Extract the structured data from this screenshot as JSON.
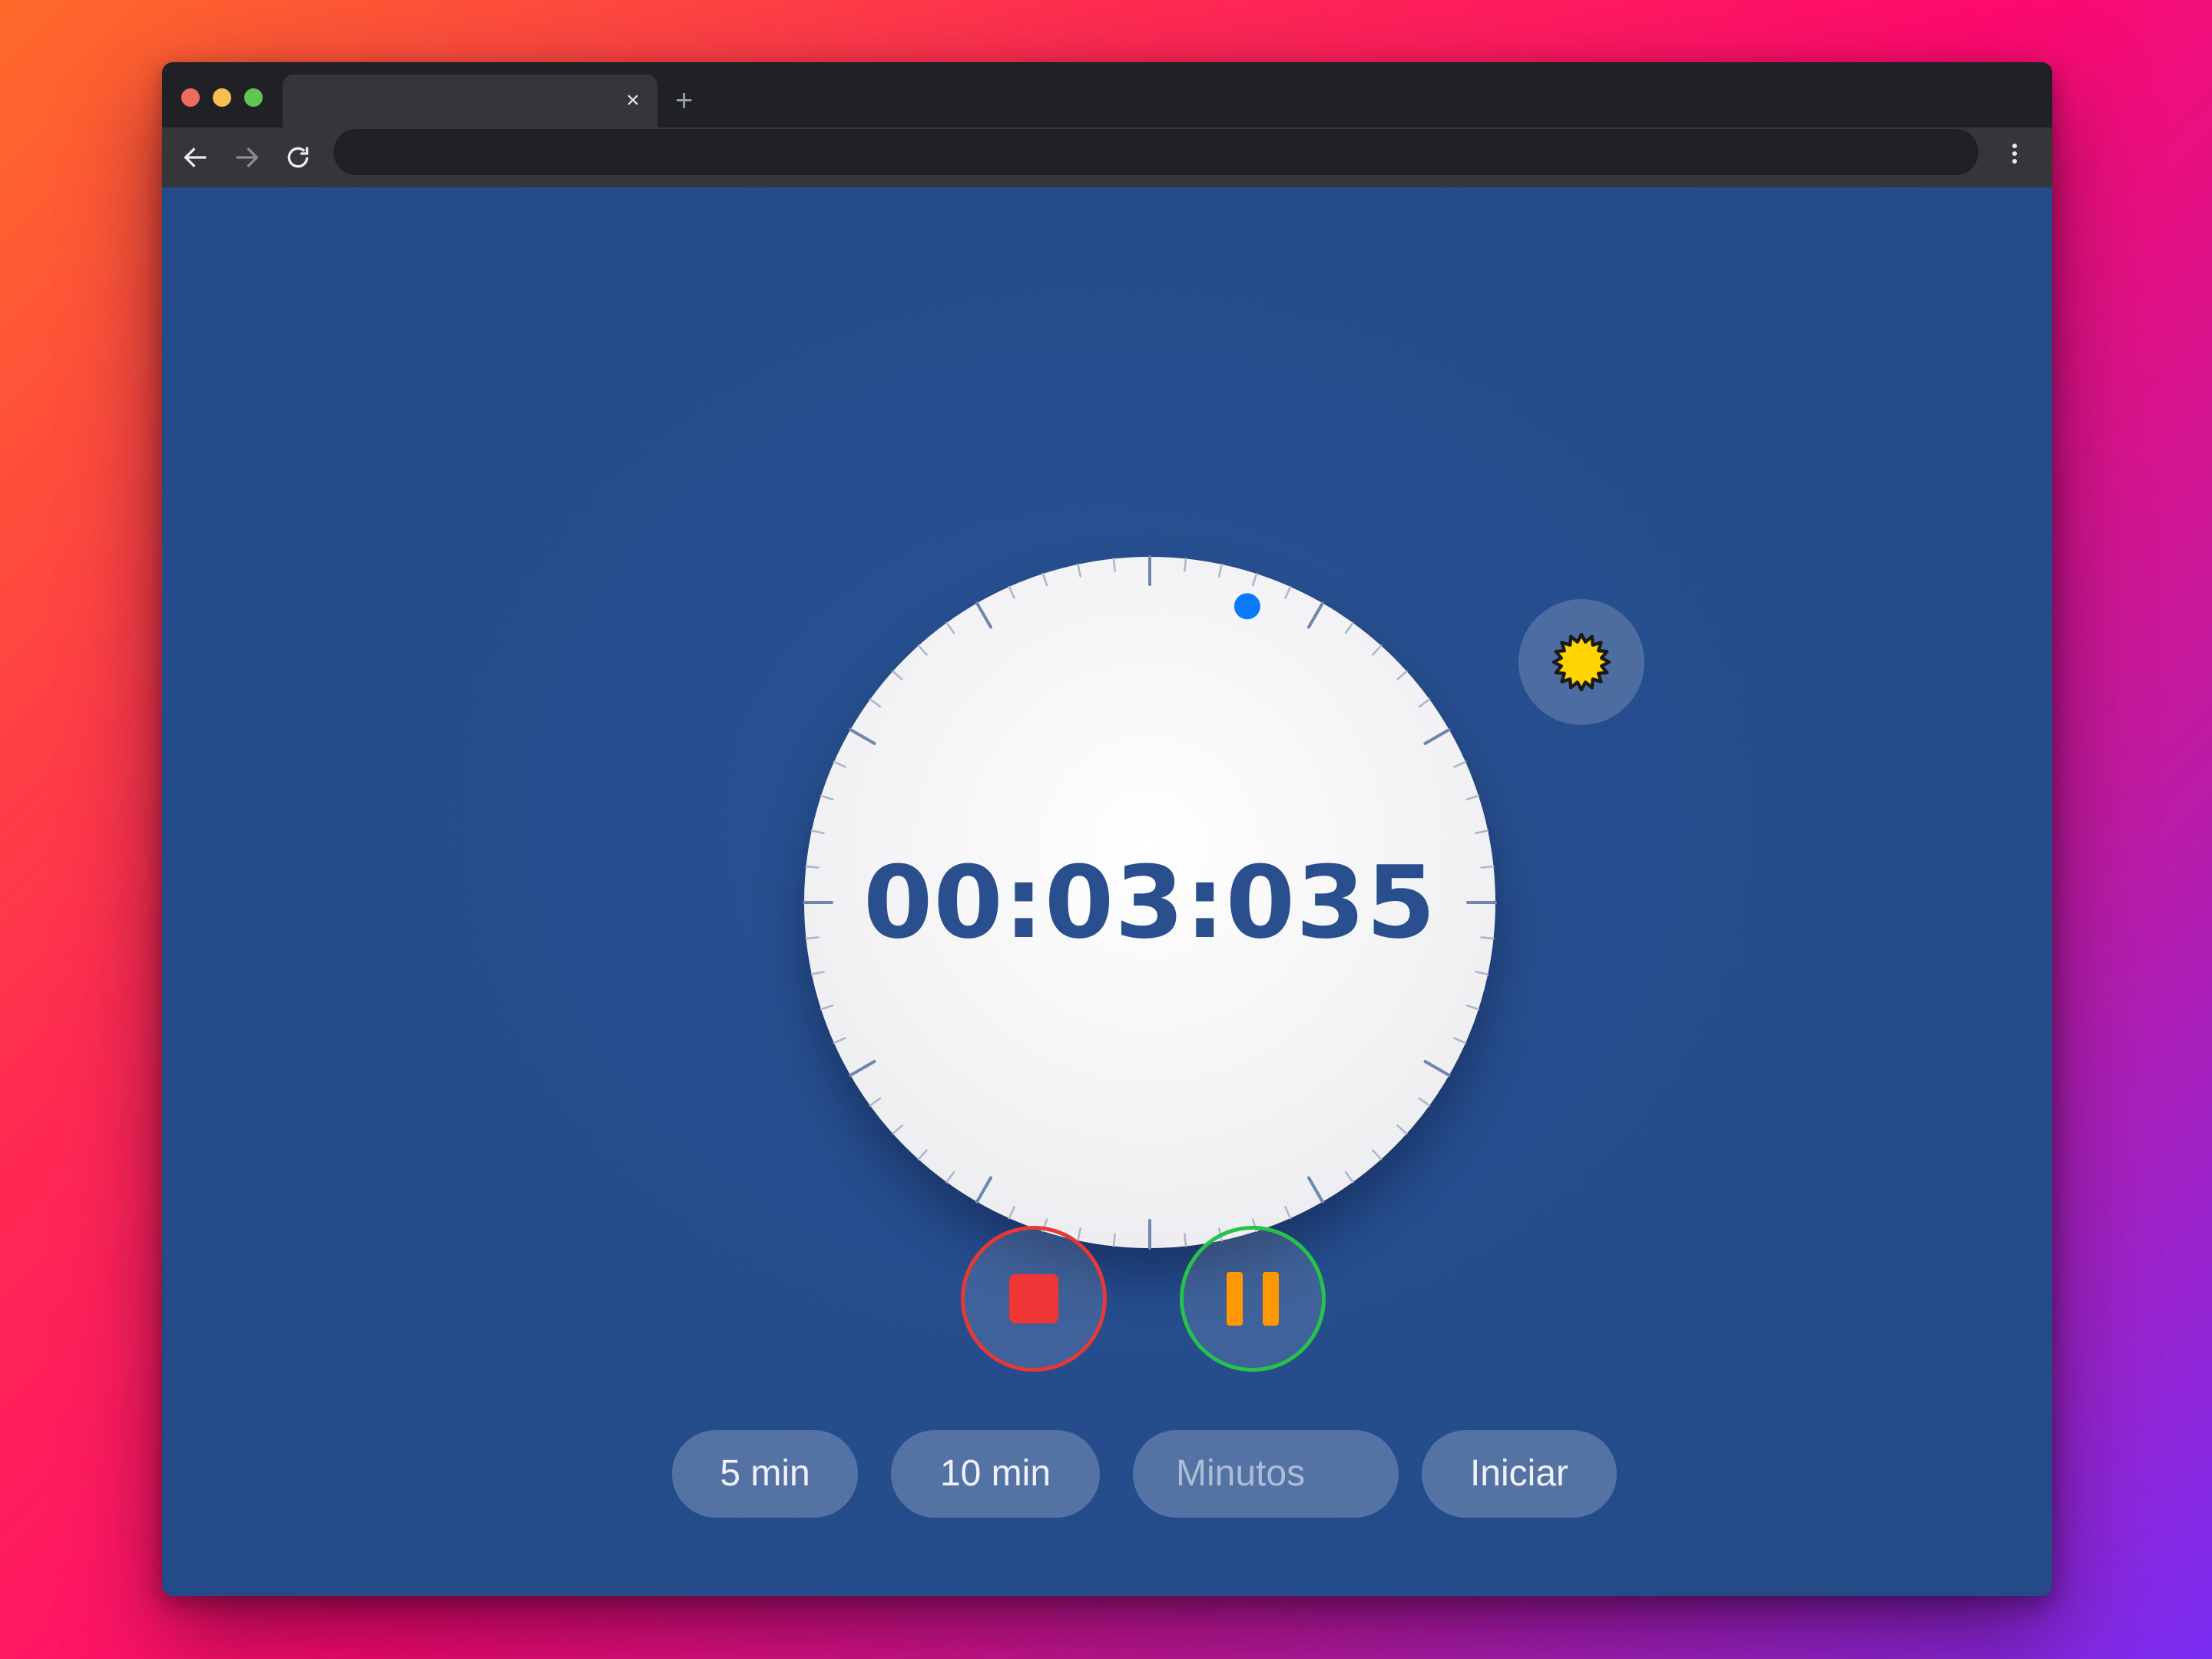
{
  "browser": {
    "tab_close": "×",
    "new_tab": "+"
  },
  "timer": {
    "display": "00:03:035",
    "elapsed_seconds": 3.035,
    "accent_color": "#0a7aff"
  },
  "controls": {
    "stop_color": "#f03636",
    "pause_color": "#ff9800"
  },
  "presets": {
    "five": "5 min",
    "ten": "10 min"
  },
  "minutes_input": {
    "placeholder": "Minutos",
    "value": ""
  },
  "start_label": "Iniciar",
  "icons": {
    "theme_toggle": "sun-icon"
  }
}
